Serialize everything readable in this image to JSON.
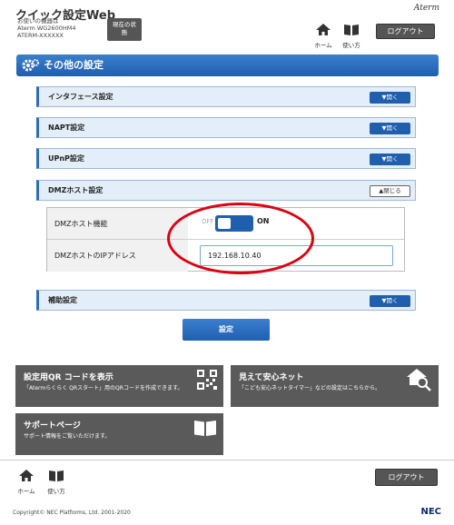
{
  "header": {
    "app_title": "クイック設定Web",
    "device_lines": [
      "お使いの機器は",
      "Aterm WG2600HM4",
      "ATERM-XXXXXX"
    ],
    "status_button": "現在の状態",
    "brand": "Aterm",
    "home_label": "ホーム",
    "usage_label": "使い方",
    "logout_label": "ログアウト"
  },
  "page": {
    "title": "その他の設定"
  },
  "sections": [
    {
      "label": "インタフェース設定",
      "button": "▼開く"
    },
    {
      "label": "NAPT設定",
      "button": "▼開く"
    },
    {
      "label": "UPnP設定",
      "button": "▼開く"
    },
    {
      "label": "DMZホスト設定",
      "button": "▲閉じる"
    }
  ],
  "dmz": {
    "function_label": "DMZホスト機能",
    "toggle_off": "OFF",
    "toggle_on": "ON",
    "ip_label": "DMZホストのIPアドレス",
    "ip_value": "192.168.10.40"
  },
  "aux_section": {
    "label": "補助設定",
    "button": "▼開く"
  },
  "submit_label": "設定",
  "cards": [
    {
      "title": "設定用QR コードを表示",
      "desc": "「Atermらくらく QRスタート」用のQRコードを作成できます。",
      "icon": "qr-code-icon"
    },
    {
      "title": "見えて安心ネット",
      "desc": "「こども安心ネットタイマー」などの設定はこちらから。",
      "icon": "house-search-icon"
    },
    {
      "title": "サポートページ",
      "desc": "サポート情報をご覧いただけます。",
      "icon": "book-icon"
    }
  ],
  "footer": {
    "home_label": "ホーム",
    "usage_label": "使い方",
    "logout_label": "ログアウト",
    "copyright": "Copyright© NEC Platforms, Ltd. 2001-2020",
    "nec": "NEC"
  },
  "colors": {
    "accent": "#1f5fae",
    "highlight": "#e00010",
    "card_bg": "#5a5a5a"
  }
}
